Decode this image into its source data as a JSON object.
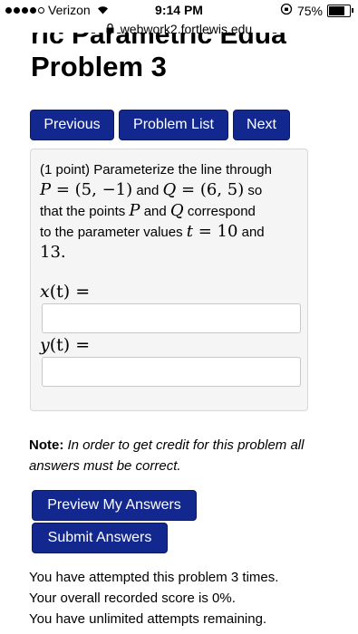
{
  "status_bar": {
    "carrier": "Verizon",
    "signal_dots_filled": 4,
    "signal_dots_total": 5,
    "time": "9:14 PM",
    "battery": "75%",
    "battery_level": 0.75
  },
  "browser": {
    "url": "webwork2.fortlewis.edu"
  },
  "header": {
    "clipped_title": "ric Parametric Equa",
    "title": "Problem 3"
  },
  "nav": {
    "previous": "Previous",
    "problem_list": "Problem List",
    "next": "Next"
  },
  "problem": {
    "points": "(1 point)",
    "text_1": "Parameterize the line through",
    "P": "P",
    "P_value": "= (5, −1)",
    "and": "and",
    "Q": "Q",
    "Q_value": "= (6, 5)",
    "so": "so",
    "text_2": "that the points",
    "and2": "and",
    "correspond": "correspond",
    "text_3": "to the parameter values",
    "t": "t",
    "t_value": "= 10",
    "and3": "and",
    "value_2": "13.",
    "x_label_var": "x",
    "x_label_rest": "(t) =",
    "y_label_var": "y",
    "y_label_rest": "(t) =",
    "x_answer": "",
    "y_answer": ""
  },
  "note": {
    "label": "Note:",
    "text": "In order to get credit for this problem all answers must be correct."
  },
  "actions": {
    "preview": "Preview My Answers",
    "submit": "Submit Answers"
  },
  "attempts": {
    "line1": "You have attempted this problem 3 times.",
    "line2": "Your overall recorded score is 0%.",
    "line3": "You have unlimited attempts remaining."
  },
  "colors": {
    "button_bg": "#13288f",
    "box_bg": "#f5f5f5"
  }
}
